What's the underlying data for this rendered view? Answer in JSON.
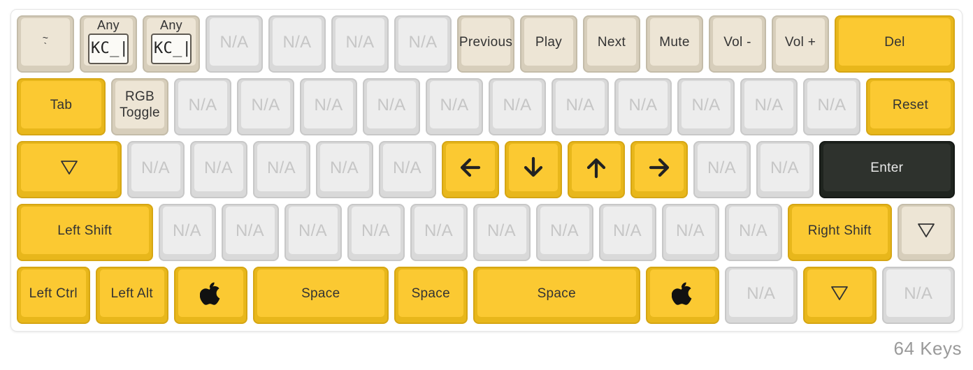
{
  "colors": {
    "accent": "#fbc932",
    "beige": "#ede5d5",
    "unassigned": "#ededed",
    "dark": "#2e322d"
  },
  "rows": [
    [
      {
        "type": "tilde",
        "legend_top": "~",
        "legend_bottom": "`",
        "color": "beige"
      },
      {
        "type": "any",
        "legend": "Any",
        "code": "KC_|",
        "color": "beige"
      },
      {
        "type": "any",
        "legend": "Any",
        "code": "KC_|",
        "color": "beige"
      },
      {
        "type": "text",
        "label": "N/A",
        "color": "grey"
      },
      {
        "type": "text",
        "label": "N/A",
        "color": "grey"
      },
      {
        "type": "text",
        "label": "N/A",
        "color": "grey"
      },
      {
        "type": "text",
        "label": "N/A",
        "color": "grey"
      },
      {
        "type": "text",
        "label": "Previous",
        "color": "beige"
      },
      {
        "type": "text",
        "label": "Play",
        "color": "beige"
      },
      {
        "type": "text",
        "label": "Next",
        "color": "beige"
      },
      {
        "type": "text",
        "label": "Mute",
        "color": "beige"
      },
      {
        "type": "text",
        "label": "Vol -",
        "color": "beige"
      },
      {
        "type": "text",
        "label": "Vol +",
        "color": "beige"
      },
      {
        "type": "text",
        "label": "Del",
        "color": "yellow"
      }
    ],
    [
      {
        "type": "text",
        "label": "Tab",
        "color": "yellow"
      },
      {
        "type": "text",
        "label": "RGB\nToggle",
        "color": "beige"
      },
      {
        "type": "text",
        "label": "N/A",
        "color": "grey"
      },
      {
        "type": "text",
        "label": "N/A",
        "color": "grey"
      },
      {
        "type": "text",
        "label": "N/A",
        "color": "grey"
      },
      {
        "type": "text",
        "label": "N/A",
        "color": "grey"
      },
      {
        "type": "text",
        "label": "N/A",
        "color": "grey"
      },
      {
        "type": "text",
        "label": "N/A",
        "color": "grey"
      },
      {
        "type": "text",
        "label": "N/A",
        "color": "grey"
      },
      {
        "type": "text",
        "label": "N/A",
        "color": "grey"
      },
      {
        "type": "text",
        "label": "N/A",
        "color": "grey"
      },
      {
        "type": "text",
        "label": "N/A",
        "color": "grey"
      },
      {
        "type": "text",
        "label": "N/A",
        "color": "grey"
      },
      {
        "type": "text",
        "label": "Reset",
        "color": "yellow"
      }
    ],
    [
      {
        "type": "icon",
        "icon": "triangle-down-icon",
        "color": "yellow"
      },
      {
        "type": "text",
        "label": "N/A",
        "color": "grey"
      },
      {
        "type": "text",
        "label": "N/A",
        "color": "grey"
      },
      {
        "type": "text",
        "label": "N/A",
        "color": "grey"
      },
      {
        "type": "text",
        "label": "N/A",
        "color": "grey"
      },
      {
        "type": "text",
        "label": "N/A",
        "color": "grey"
      },
      {
        "type": "icon",
        "icon": "arrow-left-icon",
        "color": "yellow"
      },
      {
        "type": "icon",
        "icon": "arrow-down-icon",
        "color": "yellow"
      },
      {
        "type": "icon",
        "icon": "arrow-up-icon",
        "color": "yellow"
      },
      {
        "type": "icon",
        "icon": "arrow-right-icon",
        "color": "yellow"
      },
      {
        "type": "text",
        "label": "N/A",
        "color": "grey"
      },
      {
        "type": "text",
        "label": "N/A",
        "color": "grey"
      },
      {
        "type": "text",
        "label": "Enter",
        "color": "dark"
      }
    ],
    [
      {
        "type": "text",
        "label": "Left Shift",
        "color": "yellow"
      },
      {
        "type": "text",
        "label": "N/A",
        "color": "grey"
      },
      {
        "type": "text",
        "label": "N/A",
        "color": "grey"
      },
      {
        "type": "text",
        "label": "N/A",
        "color": "grey"
      },
      {
        "type": "text",
        "label": "N/A",
        "color": "grey"
      },
      {
        "type": "text",
        "label": "N/A",
        "color": "grey"
      },
      {
        "type": "text",
        "label": "N/A",
        "color": "grey"
      },
      {
        "type": "text",
        "label": "N/A",
        "color": "grey"
      },
      {
        "type": "text",
        "label": "N/A",
        "color": "grey"
      },
      {
        "type": "text",
        "label": "N/A",
        "color": "grey"
      },
      {
        "type": "text",
        "label": "N/A",
        "color": "grey"
      },
      {
        "type": "text",
        "label": "Right Shift",
        "color": "yellow"
      },
      {
        "type": "icon",
        "icon": "triangle-down-icon",
        "color": "beige"
      }
    ],
    [
      {
        "type": "text",
        "label": "Left Ctrl",
        "color": "yellow"
      },
      {
        "type": "text",
        "label": "Left Alt",
        "color": "yellow"
      },
      {
        "type": "icon",
        "icon": "apple-icon",
        "color": "yellow"
      },
      {
        "type": "text",
        "label": "Space",
        "color": "yellow"
      },
      {
        "type": "text",
        "label": "Space",
        "color": "yellow"
      },
      {
        "type": "text",
        "label": "Space",
        "color": "yellow"
      },
      {
        "type": "icon",
        "icon": "apple-icon",
        "color": "yellow"
      },
      {
        "type": "text",
        "label": "N/A",
        "color": "grey"
      },
      {
        "type": "icon",
        "icon": "triangle-down-icon",
        "color": "yellow"
      },
      {
        "type": "text",
        "label": "N/A",
        "color": "grey"
      }
    ]
  ],
  "key_count": "64 Keys"
}
